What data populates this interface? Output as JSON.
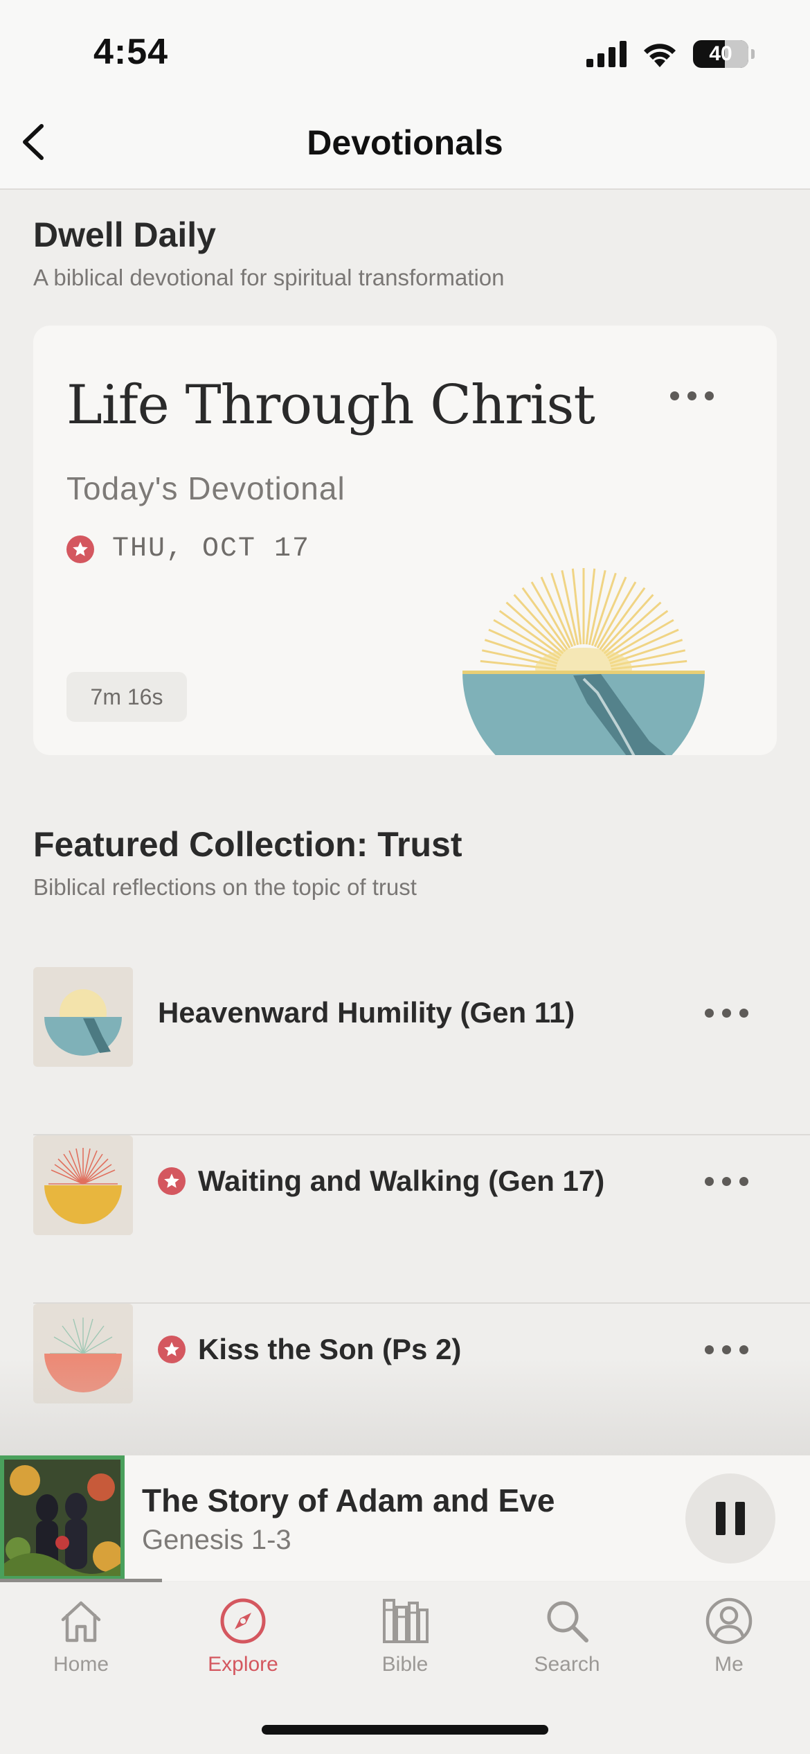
{
  "status": {
    "time": "4:54",
    "battery": "40"
  },
  "nav": {
    "title": "Devotionals"
  },
  "dwell": {
    "title": "Dwell Daily",
    "subtitle": "A biblical devotional for spiritual transformation",
    "card": {
      "title": "Life Through Christ",
      "subtitle": "Today's Devotional",
      "date": "THU, OCT 17",
      "duration": "7m 16s"
    }
  },
  "featured": {
    "title": "Featured Collection: Trust",
    "subtitle": "Biblical reflections on the topic of trust",
    "items": [
      {
        "title": "Heavenward Humility (Gen 11)",
        "starred": false
      },
      {
        "title": "Waiting and Walking (Gen 17)",
        "starred": true
      },
      {
        "title": "Kiss the Son (Ps 2)",
        "starred": true
      }
    ]
  },
  "player": {
    "title": "The Story of Adam and Eve",
    "subtitle": "Genesis 1-3",
    "progress": 0.2
  },
  "tabs": [
    {
      "label": "Home",
      "icon": "home-icon",
      "active": false
    },
    {
      "label": "Explore",
      "icon": "compass-icon",
      "active": true
    },
    {
      "label": "Bible",
      "icon": "books-icon",
      "active": false
    },
    {
      "label": "Search",
      "icon": "search-icon",
      "active": false
    },
    {
      "label": "Me",
      "icon": "profile-icon",
      "active": false
    }
  ],
  "colors": {
    "accent": "#d4575f",
    "background": "#efeeec",
    "card": "#f8f7f5",
    "sun": "#f0d484",
    "water": "#7fb1b8"
  }
}
